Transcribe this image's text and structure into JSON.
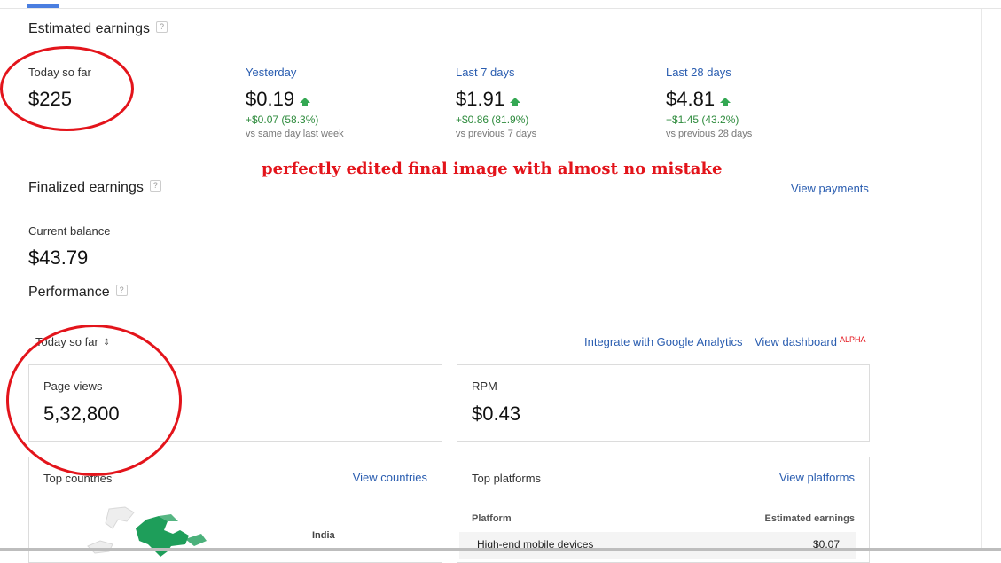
{
  "estimated": {
    "title": "Estimated earnings",
    "help": "?",
    "today_label": "Today so far",
    "today_value": "$225",
    "periods": [
      {
        "label": "Yesterday",
        "value": "$0.19",
        "delta": "+$0.07 (58.3%)",
        "compare": "vs same day last week"
      },
      {
        "label": "Last 7 days",
        "value": "$1.91",
        "delta": "+$0.86 (81.9%)",
        "compare": "vs previous 7 days"
      },
      {
        "label": "Last 28 days",
        "value": "$4.81",
        "delta": "+$1.45 (43.2%)",
        "compare": "vs previous 28 days"
      }
    ]
  },
  "annotation": "perfectly edited final image with almost no mistake",
  "finalized": {
    "title": "Finalized earnings",
    "help": "?",
    "view_payments": "View payments",
    "balance_label": "Current balance",
    "balance_value": "$43.79"
  },
  "performance": {
    "title": "Performance",
    "help": "?",
    "range_selector": "Today so far",
    "integrate_link": "Integrate with Google Analytics",
    "dashboard_link": "View dashboard",
    "dashboard_badge": "ALPHA",
    "page_views_label": "Page views",
    "page_views_value": "5,32,800",
    "rpm_label": "RPM",
    "rpm_value": "$0.43",
    "top_countries": {
      "title": "Top countries",
      "link": "View countries",
      "map_label": "India"
    },
    "top_platforms": {
      "title": "Top platforms",
      "link": "View platforms",
      "col_platform": "Platform",
      "col_earnings": "Estimated earnings",
      "rows": [
        {
          "platform": "High-end mobile devices",
          "earnings": "$0.07"
        }
      ]
    }
  },
  "colors": {
    "link": "#2a5db0",
    "positive": "#2e8b3d",
    "annotation": "#e3141b",
    "map_fill": "#1e9e5a"
  }
}
